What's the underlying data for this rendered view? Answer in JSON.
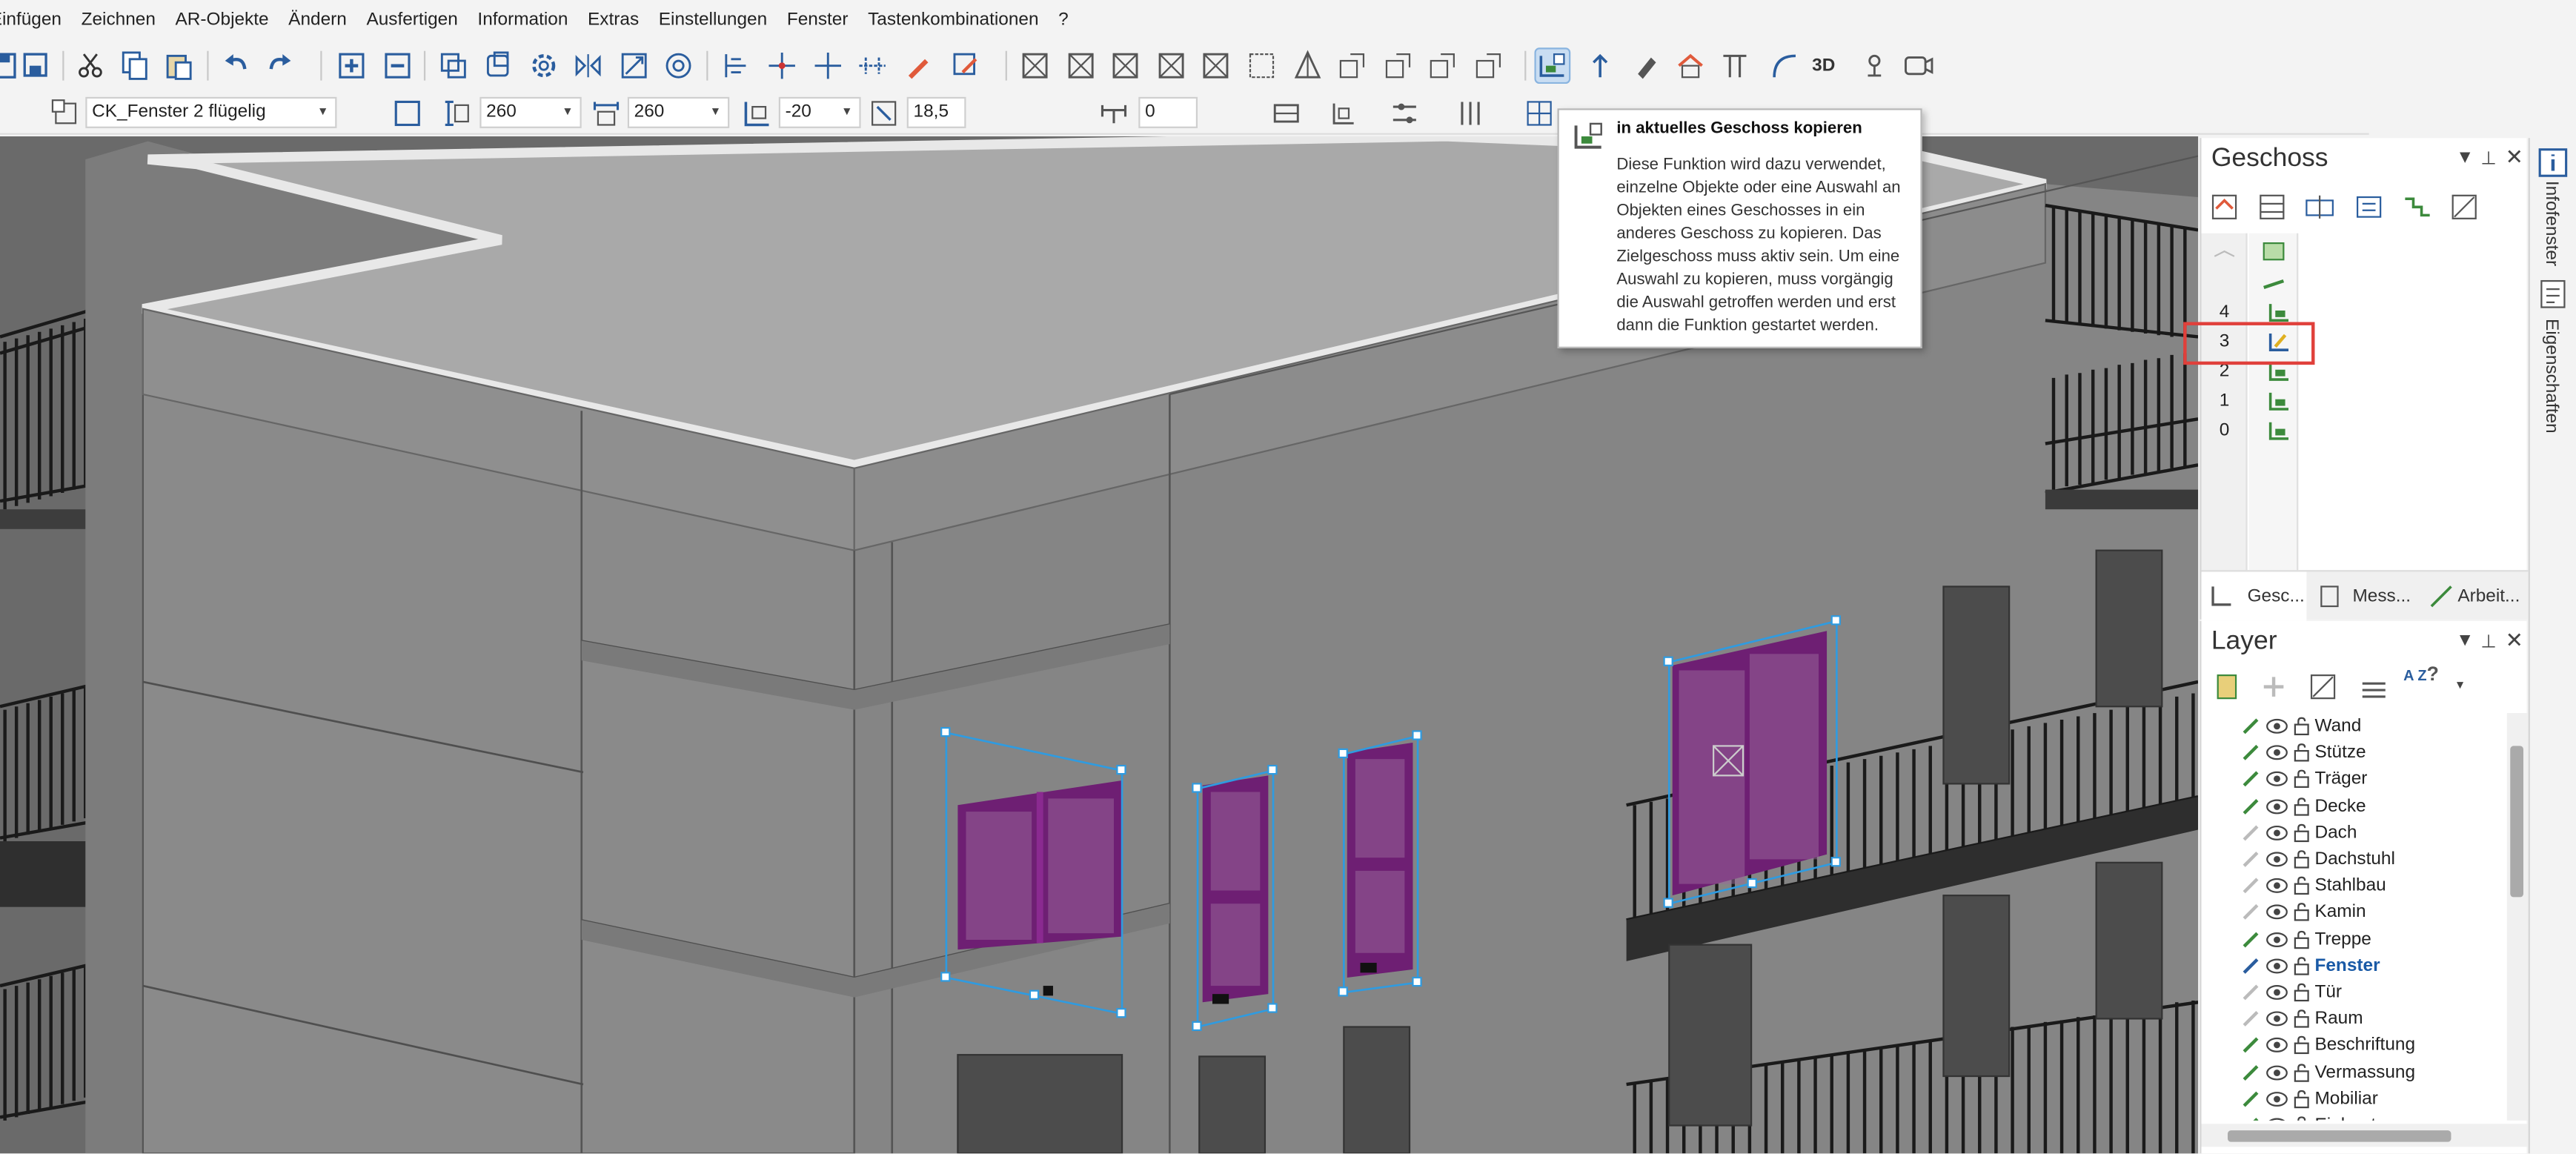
{
  "menu": [
    "Einfügen",
    "Zeichnen",
    "AR-Objekte",
    "Ändern",
    "Ausfertigen",
    "Information",
    "Extras",
    "Einstellungen",
    "Fenster",
    "Tastenkombinationen",
    "?"
  ],
  "toolbar2": {
    "window_type": "CK_Fenster 2 flügelig",
    "width": "260",
    "height": "260",
    "parapet": "-20",
    "slope": "18,5",
    "offset": "0"
  },
  "toolbar1_icons": [
    "save-icon",
    "save-as-icon",
    "cut-icon",
    "copy-icon",
    "paste-icon",
    "undo-icon",
    "redo-icon",
    "add-icon",
    "subtract-icon",
    "duplicate-icon",
    "transform-icon",
    "gear-icon",
    "mirror-icon",
    "scale-icon",
    "rotate-icon",
    "align-icon",
    "snap-icon",
    "pen-icon",
    "pick-icon",
    "view-icon",
    "copy-to-floor-icon",
    "export-icon",
    "brush-icon",
    "house-icon",
    "column-icon",
    "arc-icon",
    "3d-icon",
    "light-icon",
    "camera-icon"
  ],
  "toolbar1_label_3d": "3D",
  "tooltip": {
    "title": "in aktuelles Geschoss kopieren",
    "body": "Diese Funktion wird dazu verwendet, einzelne Objekte oder eine Auswahl an Objekten eines Geschosses in ein anderes Geschoss zu kopieren. Das Zielgeschoss muss aktiv sein. Um eine Auswahl zu kopieren, muss vorgängig die Auswahl getroffen werden und erst dann die Funktion gestartet werden."
  },
  "geschoss_panel": {
    "title": "Geschoss",
    "floors": [
      "4",
      "3",
      "2",
      "1",
      "0"
    ],
    "active_floor": "3",
    "tabs": [
      "Gesc...",
      "Mess...",
      "Arbeit..."
    ]
  },
  "layer_panel": {
    "title": "Layer",
    "az_label": "A Z",
    "question_label": "?",
    "layers": [
      {
        "name": "Wand",
        "visible": true
      },
      {
        "name": "Stütze",
        "visible": true
      },
      {
        "name": "Träger",
        "visible": true
      },
      {
        "name": "Decke",
        "visible": true
      },
      {
        "name": "Dach",
        "visible": true
      },
      {
        "name": "Dachstuhl",
        "visible": true
      },
      {
        "name": "Stahlbau",
        "visible": true
      },
      {
        "name": "Kamin",
        "visible": true
      },
      {
        "name": "Treppe",
        "visible": true
      },
      {
        "name": "Fenster",
        "visible": true,
        "active": true
      },
      {
        "name": "Tür",
        "visible": true
      },
      {
        "name": "Raum",
        "visible": true
      },
      {
        "name": "Beschriftung",
        "visible": true
      },
      {
        "name": "Vermassung",
        "visible": true
      },
      {
        "name": "Mobiliar",
        "visible": true
      },
      {
        "name": "Einbauten",
        "visible": true
      }
    ]
  },
  "side_tabs": [
    "Infofenster",
    "Eigenschaften"
  ],
  "colors": {
    "accent": "#1a5aa6",
    "selection": "#2f9be0",
    "window_glass": "#7a1f7e",
    "highlight_box": "#e0403b",
    "layer_green": "#3c8a3c"
  }
}
